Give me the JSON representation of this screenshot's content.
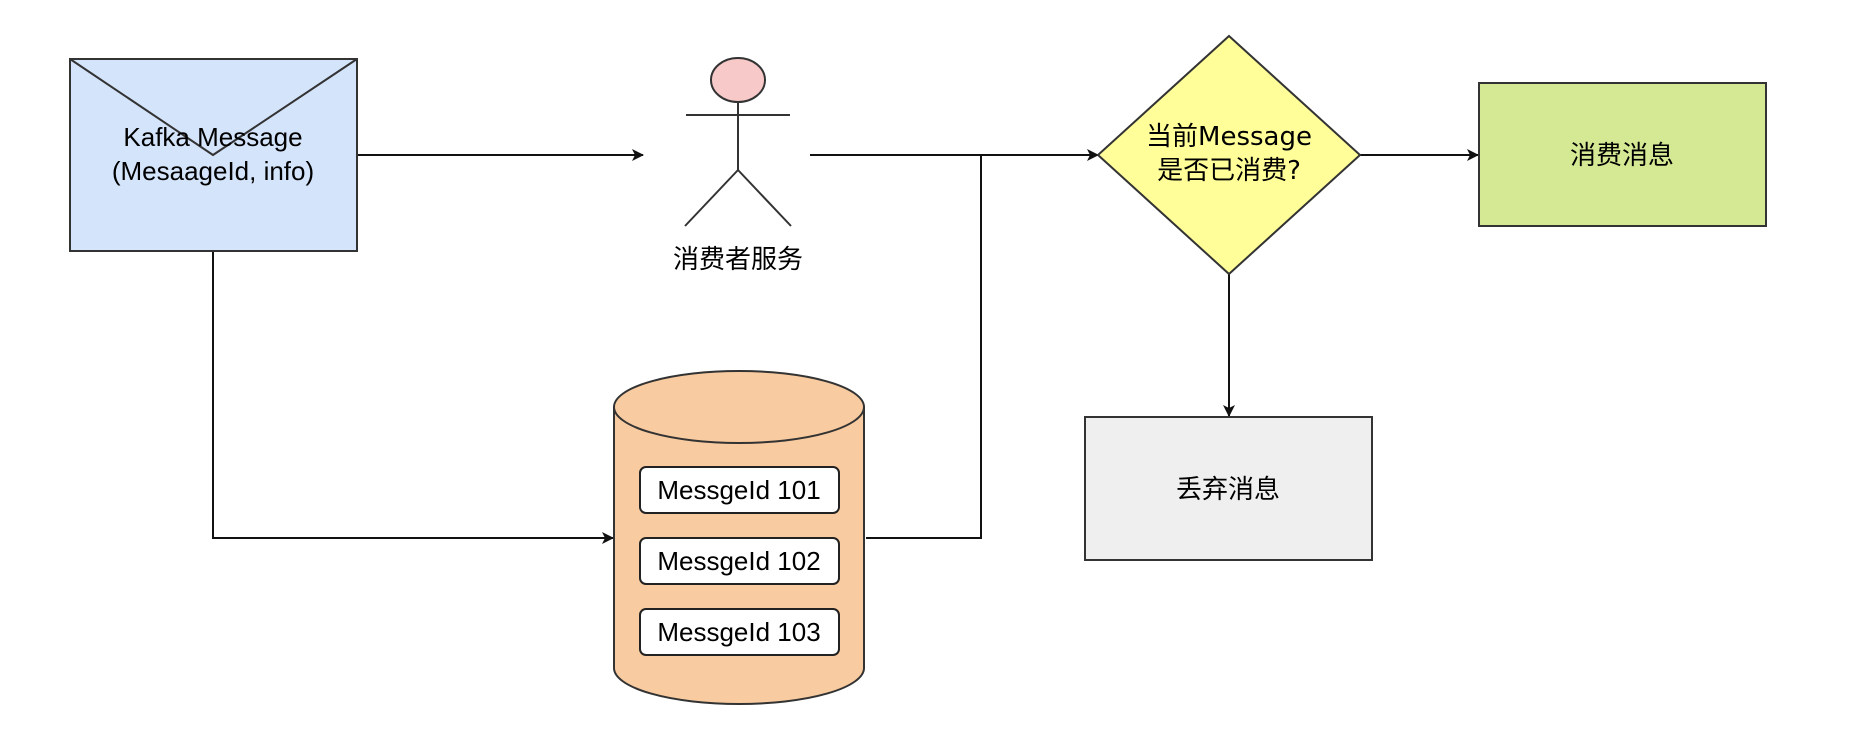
{
  "nodes": {
    "kafka_message": {
      "line1": "Kafka Message",
      "line2": "(MesaageId, info)",
      "fill": "#d4e4fb"
    },
    "consumer_service": {
      "label": "消费者服务",
      "head_fill": "#f7c9c9"
    },
    "message_store": {
      "fill": "#f8cba0",
      "items": [
        "MessgeId 101",
        "MessgeId 102",
        "MessgeId 103"
      ]
    },
    "decision": {
      "line1": "当前Message",
      "line2": "是否已消费?",
      "fill": "#fffe99"
    },
    "consume_box": {
      "label": "消费消息",
      "fill": "#d5e894"
    },
    "discard_box": {
      "label": "丢弃消息",
      "fill": "#efefef"
    }
  },
  "colors": {
    "stroke": "#333333",
    "edge": "#111111"
  }
}
